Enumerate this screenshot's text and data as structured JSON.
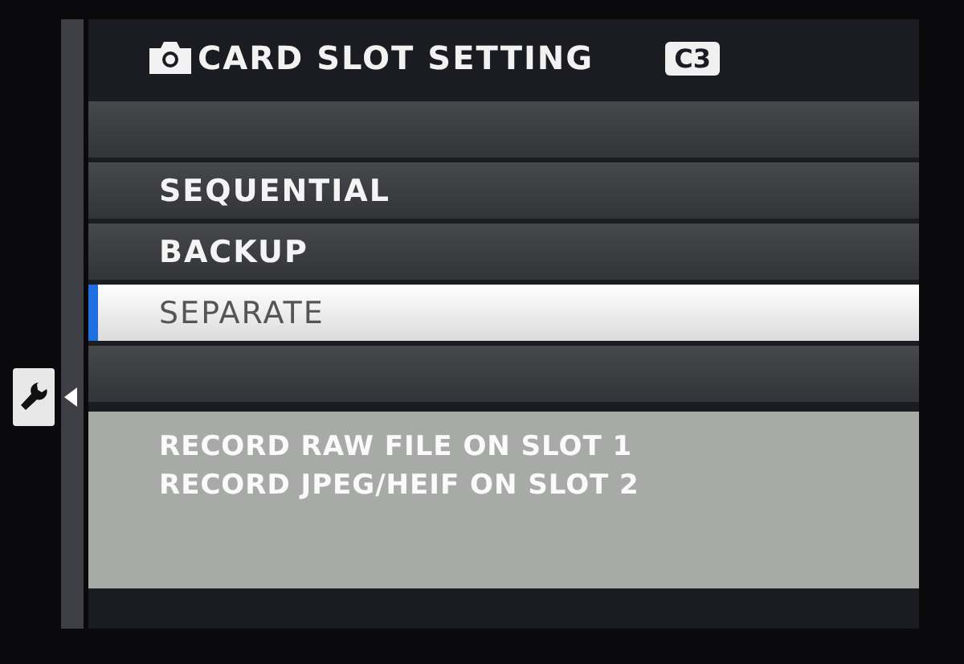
{
  "header": {
    "title": "CARD SLOT SETTING",
    "badge": "C3"
  },
  "options": [
    {
      "label": "SEQUENTIAL",
      "selected": false
    },
    {
      "label": "BACKUP",
      "selected": false
    },
    {
      "label": "SEPARATE",
      "selected": true
    }
  ],
  "description": [
    "RECORD RAW FILE ON SLOT 1",
    "RECORD JPEG/HEIF ON SLOT 2"
  ]
}
